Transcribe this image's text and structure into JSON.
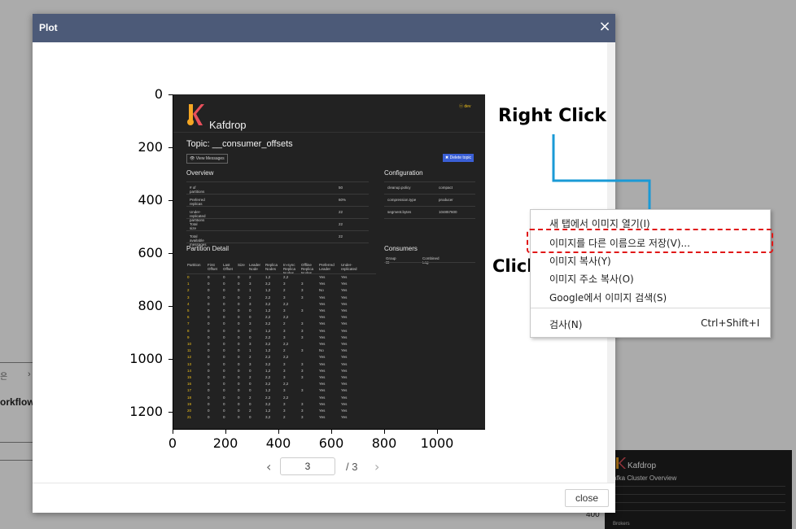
{
  "background": {
    "left_text_fragment": "orkflow",
    "left_small_1": "은",
    "left_small_2": "›",
    "thumb": {
      "brand": "Kafdrop",
      "title": "afka Cluster Overview",
      "footer": "Brokers",
      "axis_label": "400"
    }
  },
  "modal": {
    "title": "Plot",
    "close_icon": "×",
    "close_button": "close",
    "pagination": {
      "prev": "‹",
      "current": "3",
      "total": "/ 3",
      "next": "›"
    }
  },
  "plot": {
    "y_ticks": [
      "0",
      "200",
      "400",
      "600",
      "800",
      "1000",
      "1200"
    ],
    "x_ticks": [
      "0",
      "200",
      "400",
      "600",
      "800",
      "1000"
    ],
    "image": {
      "brand": "Kafdrop",
      "user": "ⓞ dev",
      "topic": "Topic: __consumer_offsets",
      "view_messages": "👁 View Messages",
      "delete_topic": "✖ Delete topic",
      "overview_heading": "Overview",
      "configuration_heading": "Configuration",
      "partition_detail_heading": "Partition Detail",
      "consumers_heading": "Consumers",
      "overview_rows": [
        {
          "label": "# of partitions",
          "value": "50"
        },
        {
          "label": "Preferred replicas",
          "value": "60%"
        },
        {
          "label": "Under-replicated partitions",
          "value": "22"
        },
        {
          "label": "Total size",
          "value": "22"
        },
        {
          "label": "Total available messages",
          "value": "22"
        }
      ],
      "configuration_rows": [
        {
          "label": "cleanup.policy",
          "value": "compact"
        },
        {
          "label": "compression.type",
          "value": "producer"
        },
        {
          "label": "segment.bytes",
          "value": "104857600"
        }
      ],
      "consumers_header": [
        "Group ID",
        "Combined Lag"
      ],
      "partition_header": [
        "Partition",
        "First Offset",
        "Last Offset",
        "Size",
        "Leader Node",
        "Replica Nodes",
        "In-sync Replica Nodes",
        "Offline Replica Nodes",
        "Preferred Leader",
        "Under-replicated"
      ],
      "partition_rows": [
        [
          "0",
          "0",
          "0",
          "0",
          "2",
          "1,2",
          "2,2",
          "",
          "Yes",
          "Yes"
        ],
        [
          "1",
          "0",
          "0",
          "0",
          "3",
          "3,2",
          "3",
          "3",
          "Yes",
          "Yes"
        ],
        [
          "2",
          "0",
          "0",
          "0",
          "1",
          "1,2",
          "2",
          "3",
          "No",
          "Yes"
        ],
        [
          "3",
          "0",
          "0",
          "0",
          "2",
          "2,2",
          "3",
          "3",
          "Yes",
          "Yes"
        ],
        [
          "4",
          "0",
          "0",
          "0",
          "3",
          "3,2",
          "2,2",
          "",
          "Yes",
          "Yes"
        ],
        [
          "5",
          "0",
          "0",
          "0",
          "0",
          "1,2",
          "3",
          "3",
          "Yes",
          "Yes"
        ],
        [
          "6",
          "0",
          "0",
          "0",
          "0",
          "2,2",
          "2,2",
          "",
          "Yes",
          "Yes"
        ],
        [
          "7",
          "0",
          "0",
          "0",
          "3",
          "3,2",
          "2",
          "3",
          "Yes",
          "Yes"
        ],
        [
          "8",
          "0",
          "0",
          "0",
          "0",
          "1,2",
          "3",
          "3",
          "Yes",
          "Yes"
        ],
        [
          "9",
          "0",
          "0",
          "0",
          "0",
          "2,2",
          "3",
          "3",
          "Yes",
          "Yes"
        ],
        [
          "10",
          "0",
          "0",
          "0",
          "3",
          "3,2",
          "2,2",
          "",
          "Yes",
          "Yes"
        ],
        [
          "11",
          "0",
          "0",
          "0",
          "1",
          "1,2",
          "2",
          "3",
          "No",
          "Yes"
        ],
        [
          "12",
          "0",
          "0",
          "0",
          "2",
          "2,2",
          "2,2",
          "",
          "Yes",
          "Yes"
        ],
        [
          "13",
          "0",
          "0",
          "0",
          "3",
          "3,2",
          "3",
          "3",
          "Yes",
          "Yes"
        ],
        [
          "14",
          "0",
          "0",
          "0",
          "0",
          "1,2",
          "3",
          "3",
          "Yes",
          "Yes"
        ],
        [
          "15",
          "0",
          "0",
          "0",
          "2",
          "2,2",
          "3",
          "3",
          "Yes",
          "Yes"
        ],
        [
          "16",
          "0",
          "0",
          "0",
          "0",
          "3,2",
          "2,2",
          "",
          "Yes",
          "Yes"
        ],
        [
          "17",
          "0",
          "0",
          "0",
          "0",
          "1,2",
          "3",
          "3",
          "Yes",
          "Yes"
        ],
        [
          "18",
          "0",
          "0",
          "0",
          "2",
          "2,2",
          "2,2",
          "",
          "Yes",
          "Yes"
        ],
        [
          "19",
          "0",
          "0",
          "0",
          "0",
          "3,2",
          "3",
          "3",
          "Yes",
          "Yes"
        ],
        [
          "20",
          "0",
          "0",
          "0",
          "2",
          "1,2",
          "3",
          "3",
          "Yes",
          "Yes"
        ],
        [
          "21",
          "0",
          "0",
          "0",
          "0",
          "3,2",
          "2",
          "3",
          "Yes",
          "Yes"
        ]
      ]
    }
  },
  "annotations": {
    "right_click": "Right Click",
    "click": "Click",
    "arrow_color": "#1a9ad6",
    "highlight_color": "#e01818"
  },
  "context_menu": {
    "items": [
      {
        "label": "새 탭에서 이미지 열기(I)",
        "shortcut": ""
      },
      {
        "label": "이미지를 다른 이름으로 저장(V)...",
        "shortcut": ""
      },
      {
        "label": "이미지 복사(Y)",
        "shortcut": ""
      },
      {
        "label": "이미지 주소 복사(O)",
        "shortcut": ""
      },
      {
        "label": "Google에서 이미지 검색(S)",
        "shortcut": ""
      },
      {
        "label": "검사(N)",
        "shortcut": "Ctrl+Shift+I"
      }
    ]
  }
}
